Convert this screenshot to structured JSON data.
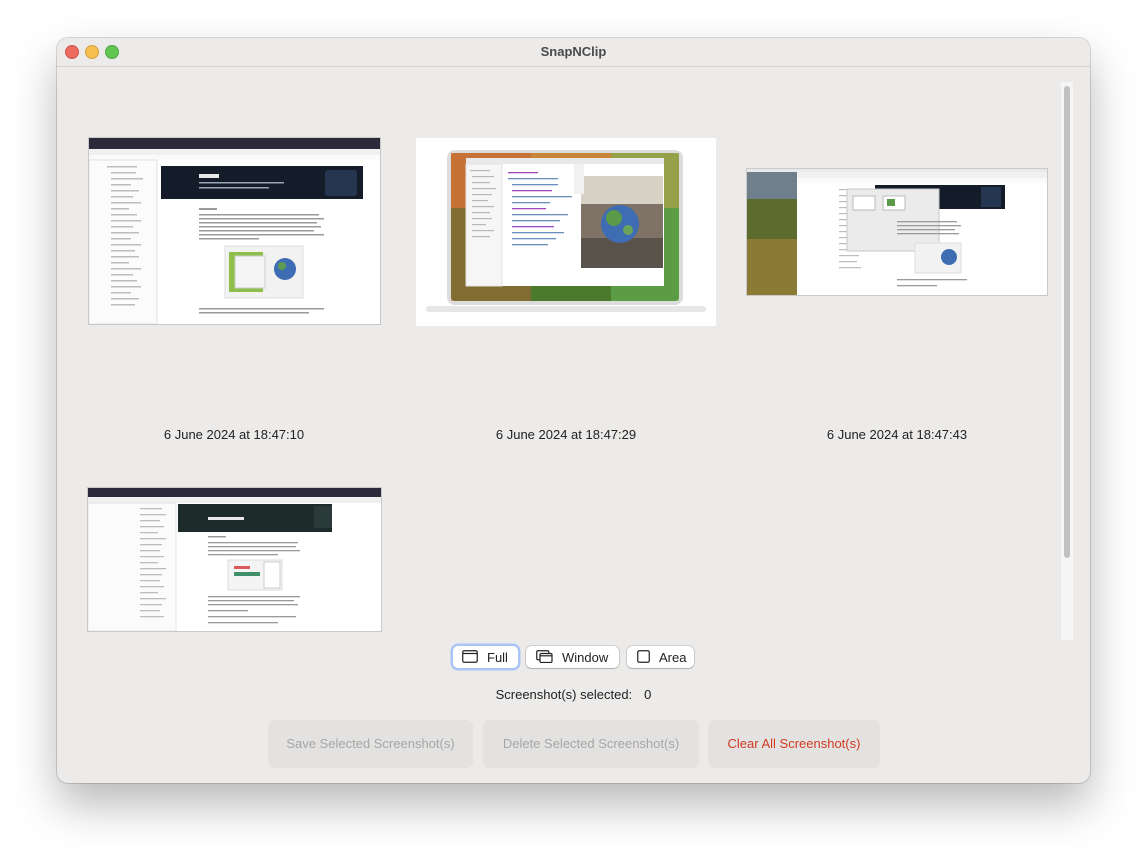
{
  "window": {
    "title": "SnapNClip"
  },
  "screenshots": [
    {
      "timestamp": "6 June 2024 at 18:47:10"
    },
    {
      "timestamp": "6 June 2024 at 18:47:29"
    },
    {
      "timestamp": "6 June 2024 at 18:47:43"
    },
    {
      "timestamp": ""
    }
  ],
  "capture_modes": [
    {
      "label": "Full",
      "icon": "full-screen-icon",
      "selected": true
    },
    {
      "label": "Window",
      "icon": "window-icon",
      "selected": false
    },
    {
      "label": "Area",
      "icon": "area-icon",
      "selected": false
    }
  ],
  "status": {
    "label": "Screenshot(s) selected:",
    "count": "0"
  },
  "actions": {
    "save_label": "Save Selected Screenshot(s)",
    "delete_label": "Delete Selected Screenshot(s)",
    "clear_label": "Clear All Screenshot(s)"
  },
  "colors": {
    "accent": "#a9c4f5",
    "danger": "#d13b21",
    "window_bg": "#ecebea"
  }
}
